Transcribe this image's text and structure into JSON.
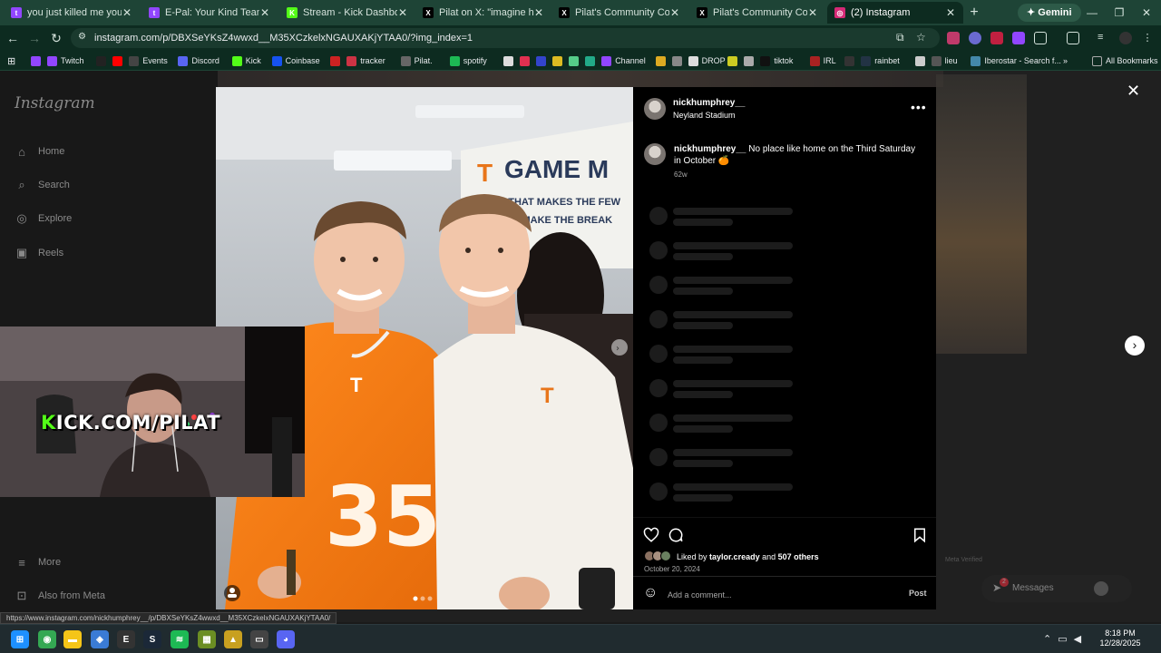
{
  "browser": {
    "tabs": [
      {
        "title": "you just killed me you - Twitch",
        "favicon": "twitch-icon",
        "color": "#9146ff",
        "glyph": "t"
      },
      {
        "title": "E-Pal: Your Kind Teammates",
        "favicon": "twitch-icon",
        "color": "#9146ff",
        "glyph": "t"
      },
      {
        "title": "Stream - Kick Dashboard",
        "favicon": "kick-icon",
        "color": "#53fc18",
        "glyph": "K"
      },
      {
        "title": "Pilat on X: \"imagine having a",
        "favicon": "x-icon",
        "color": "#000000",
        "glyph": "X"
      },
      {
        "title": "Pilat's Community Community",
        "favicon": "x-icon",
        "color": "#000000",
        "glyph": "X"
      },
      {
        "title": "Pilat's Community Community",
        "favicon": "x-icon",
        "color": "#000000",
        "glyph": "X"
      },
      {
        "title": "(2) Instagram",
        "favicon": "instagram-icon",
        "color": "#d62976",
        "glyph": "◎"
      }
    ],
    "new_tab": "+",
    "gemini_label": "Gemini",
    "url": "instagram.com/p/DBXSeYKsZ4wwxd__M35XCzkelxNGAUXAKjYTAA0/?img_index=1",
    "bookmarks": [
      {
        "label": "",
        "color": "#9146ff"
      },
      {
        "label": "Twitch",
        "color": "#9146ff"
      },
      {
        "label": "",
        "color": "#222222"
      },
      {
        "label": "",
        "color": "#ff0000"
      },
      {
        "label": "Events",
        "color": "#444444"
      },
      {
        "label": "Discord",
        "color": "#5865f2"
      },
      {
        "label": "Kick",
        "color": "#53fc18"
      },
      {
        "label": "Coinbase",
        "color": "#1652f0"
      },
      {
        "label": "",
        "color": "#cc2222"
      },
      {
        "label": "tracker",
        "color": "#cc3344"
      },
      {
        "label": "Pilat.",
        "color": "#666666"
      },
      {
        "label": "spotify",
        "color": "#1db954"
      },
      {
        "label": "",
        "color": "#dddddd"
      },
      {
        "label": "",
        "color": "#e03050"
      },
      {
        "label": "",
        "color": "#3344cc"
      },
      {
        "label": "",
        "color": "#ddbb22"
      },
      {
        "label": "",
        "color": "#55cc88"
      },
      {
        "label": "",
        "color": "#22aa88"
      },
      {
        "label": "Channel",
        "color": "#9146ff"
      },
      {
        "label": "",
        "color": "#ddaa22"
      },
      {
        "label": "",
        "color": "#888888"
      },
      {
        "label": "DROP",
        "color": "#dddddd"
      },
      {
        "label": "",
        "color": "#cccc22"
      },
      {
        "label": "",
        "color": "#aaaaaa"
      },
      {
        "label": "tiktok",
        "color": "#111111"
      },
      {
        "label": "IRL",
        "color": "#aa2222"
      },
      {
        "label": "",
        "color": "#333333"
      },
      {
        "label": "rainbet",
        "color": "#223344"
      },
      {
        "label": "",
        "color": "#cccccc"
      },
      {
        "label": "lieu",
        "color": "#555555"
      },
      {
        "label": "Iberostar - Search f...",
        "color": "#4488aa"
      }
    ],
    "all_bookmarks": "All Bookmarks",
    "status_url": "https://www.instagram.com/nickhumphrey__/p/DBXSeYKsZ4wwxd__M35XCzkelxNGAUXAKjYTAA0/"
  },
  "sidebar": {
    "logo": "Instagram",
    "items": [
      {
        "label": "Home",
        "icon": "home-icon",
        "glyph": "⌂"
      },
      {
        "label": "Search",
        "icon": "search-icon",
        "glyph": "⌕"
      },
      {
        "label": "Explore",
        "icon": "explore-icon",
        "glyph": "◎"
      },
      {
        "label": "Reels",
        "icon": "reels-icon",
        "glyph": "▣"
      }
    ],
    "more": "More",
    "also_from_meta": "Also from Meta"
  },
  "post": {
    "username": "nickhumphrey__",
    "location": "Neyland Stadium",
    "caption_user": "nickhumphrey__",
    "caption_text": "No place like home on the Third Saturday in October",
    "caption_emoji": "🍊",
    "caption_age": "62w",
    "liked_by_prefix": "Liked by",
    "liked_by_user": "taylor.cready",
    "liked_by_and": "and",
    "liked_by_others": "507 others",
    "date": "October 20, 2024",
    "comment_placeholder": "Add a comment...",
    "post_label": "Post",
    "photo_banner": "GAME M",
    "photo_slogan1": "TEAM THAT MAKES THE FEW",
    "photo_slogan2": "R AND MAKE THE BREAK",
    "jersey_number": "35"
  },
  "overlay": {
    "meta_verified": "Meta Verified",
    "messages": "Messages",
    "messages_badge": "2",
    "stream_prefix": "K",
    "stream_text": "ICK.COM/PILAT"
  },
  "taskbar": {
    "time": "8:18 PM",
    "date": "12/28/2025",
    "apps": [
      {
        "icon": "windows-start-icon",
        "color": "#1e90ff",
        "glyph": "⊞"
      },
      {
        "icon": "chrome-icon",
        "color": "#34a853",
        "glyph": "◉"
      },
      {
        "icon": "file-explorer-icon",
        "color": "#f5c518",
        "glyph": "▬"
      },
      {
        "icon": "app-icon",
        "color": "#3a7bd5",
        "glyph": "◈"
      },
      {
        "icon": "epic-games-icon",
        "color": "#333333",
        "glyph": "E"
      },
      {
        "icon": "steam-icon",
        "color": "#1b2838",
        "glyph": "S"
      },
      {
        "icon": "spotify-icon",
        "color": "#1db954",
        "glyph": "≋"
      },
      {
        "icon": "minecraft-icon",
        "color": "#6b8e23",
        "glyph": "▦"
      },
      {
        "icon": "app-icon-2",
        "color": "#c8a020",
        "glyph": "▲"
      },
      {
        "icon": "app-icon-3",
        "color": "#444444",
        "glyph": "▭"
      },
      {
        "icon": "discord-icon",
        "color": "#5865f2",
        "glyph": "◕"
      }
    ]
  }
}
